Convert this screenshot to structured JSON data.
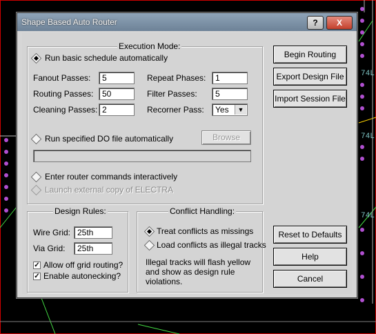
{
  "window": {
    "title": "Shape Based Auto Router",
    "help_button": "?",
    "close_button": "X"
  },
  "execution": {
    "legend": "Execution Mode:",
    "run_basic": "Run basic schedule automatically",
    "fanout_label": "Fanout Passes:",
    "fanout_value": "5",
    "repeat_label": "Repeat Phases:",
    "repeat_value": "1",
    "routing_label": "Routing Passes:",
    "routing_value": "50",
    "filter_label": "Filter Passes:",
    "filter_value": "5",
    "cleaning_label": "Cleaning Passes:",
    "cleaning_value": "2",
    "recorner_label": "Recorner Pass:",
    "recorner_value": "Yes",
    "run_do": "Run specified DO file automatically",
    "browse": "Browse",
    "do_file_value": "",
    "interactive": "Enter router commands interactively",
    "launch_electra": "Launch external copy of ELECTRA"
  },
  "design_rules": {
    "legend": "Design Rules:",
    "wire_grid_label": "Wire Grid:",
    "wire_grid_value": "25th",
    "via_grid_label": "Via Grid:",
    "via_grid_value": "25th",
    "allow_off_grid": "Allow off grid routing?",
    "enable_autonecking": "Enable autonecking?"
  },
  "conflict": {
    "legend": "Conflict Handling:",
    "treat_missing": "Treat conflicts as missings",
    "load_illegal": "Load conflicts as illegal tracks",
    "note": "Illegal tracks will flash yellow and show as design rule violations."
  },
  "buttons": {
    "begin": "Begin Routing",
    "export": "Export Design File",
    "import": "Import Session File",
    "reset": "Reset to Defaults",
    "help": "Help",
    "cancel": "Cancel"
  },
  "pcb_labels": {
    "right_1": "74L",
    "right_2": "74L",
    "right_3": "74L"
  }
}
